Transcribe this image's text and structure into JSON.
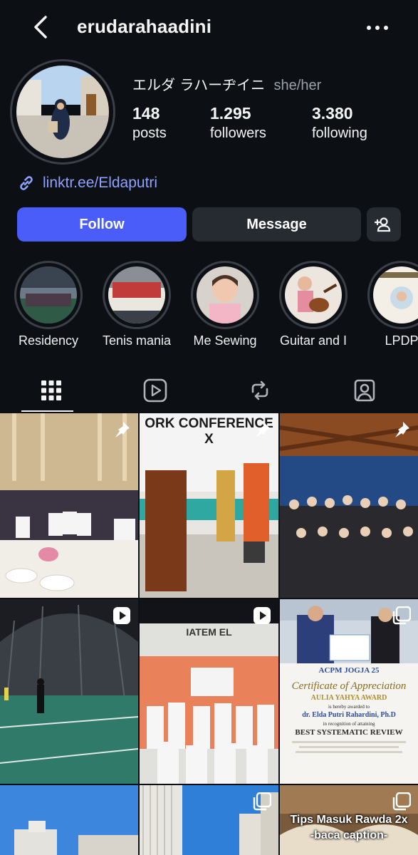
{
  "header": {
    "username": "erudarahaadini"
  },
  "profile": {
    "display_name": "エルダ ラハーヂイニ",
    "pronouns": "she/her",
    "stats": [
      {
        "value": "148",
        "label": "posts"
      },
      {
        "value": "1.295",
        "label": "followers"
      },
      {
        "value": "3.380",
        "label": "following"
      }
    ],
    "link_text": "linktr.ee/Eldaputri"
  },
  "actions": {
    "follow_label": "Follow",
    "message_label": "Message"
  },
  "highlights": [
    {
      "label": "Residency"
    },
    {
      "label": "Tenis mania"
    },
    {
      "label": "Me Sewing"
    },
    {
      "label": "Guitar and I"
    },
    {
      "label": "LPDP"
    }
  ],
  "posts": [
    {
      "badge": "pin",
      "banner": ""
    },
    {
      "badge": "pin",
      "banner": "ORK CONFERENCE X"
    },
    {
      "badge": "pin",
      "banner": ""
    },
    {
      "badge": "reel",
      "banner": ""
    },
    {
      "badge": "reel",
      "banner": "IATEM EL"
    },
    {
      "badge": "carousel",
      "banner": ""
    },
    {
      "badge": "",
      "banner": ""
    },
    {
      "badge": "carousel",
      "banner": ""
    },
    {
      "badge": "carousel",
      "banner": "Tips Masuk Rawda 2x",
      "banner2": "-baca caption-"
    }
  ],
  "certificate": {
    "logo": "ACPM JOGJA 25",
    "title": "Certificate of Appreciation",
    "award": "AULIA YAHYA AWARD",
    "awarded_to": "is hereby awarded to",
    "name": "dr. Elda Putri Rahardini, Ph.D",
    "recognition": "in recognition of attaining",
    "category": "BEST SYSTEMATIC REVIEW"
  },
  "colors": {
    "background": "#0c0f14",
    "follow_button": "#4a5df9",
    "secondary_button": "#262a31",
    "link": "#8ea2ff"
  }
}
